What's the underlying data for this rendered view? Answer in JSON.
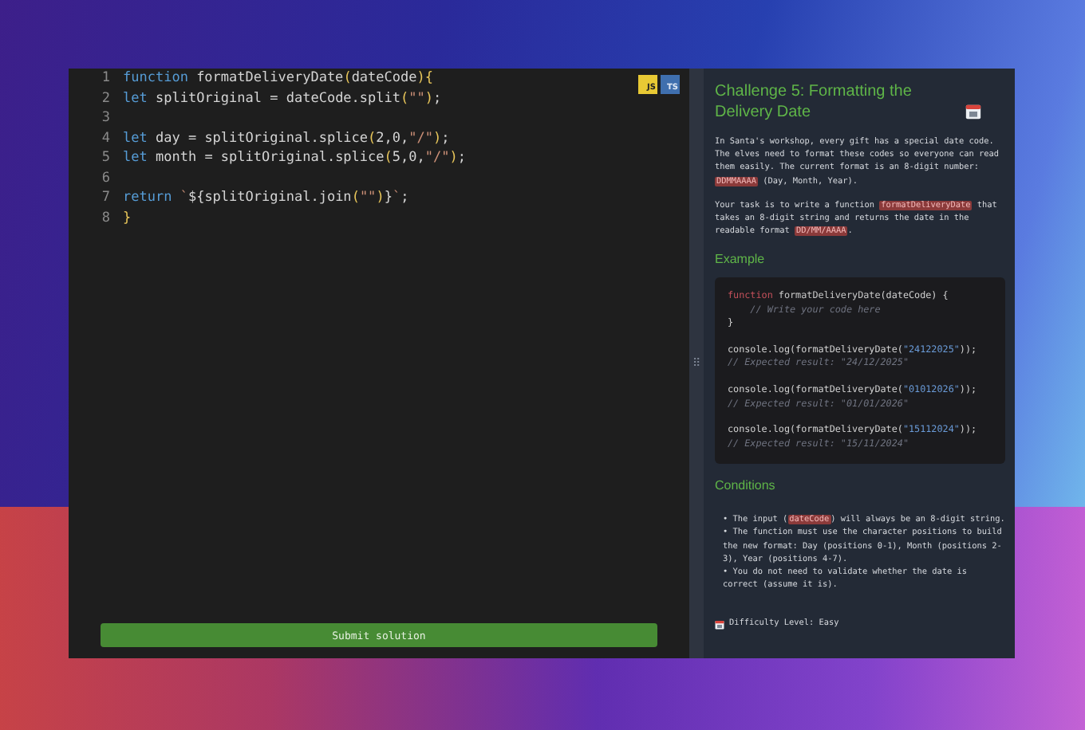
{
  "editor": {
    "badges": [
      {
        "kind": "js",
        "label": "JS"
      },
      {
        "kind": "ts",
        "label": "TS"
      }
    ],
    "lines": [
      {
        "number": "1",
        "tokens": [
          {
            "kind": "keyword",
            "text": "function "
          },
          {
            "kind": "plain",
            "text": "formatDeliveryDate"
          },
          {
            "kind": "brace",
            "text": "("
          },
          {
            "kind": "plain",
            "text": "dateCode"
          },
          {
            "kind": "brace",
            "text": "){"
          }
        ]
      },
      {
        "number": "2",
        "tokens": [
          {
            "kind": "keyword",
            "text": "let "
          },
          {
            "kind": "plain",
            "text": "splitOriginal = dateCode.split"
          },
          {
            "kind": "brace",
            "text": "("
          },
          {
            "kind": "string",
            "text": "\"\""
          },
          {
            "kind": "brace",
            "text": ")"
          },
          {
            "kind": "plain",
            "text": ";"
          }
        ]
      },
      {
        "number": "3"
      },
      {
        "number": "4",
        "tokens": [
          {
            "kind": "keyword",
            "text": "let "
          },
          {
            "kind": "plain",
            "text": "day = splitOriginal.splice"
          },
          {
            "kind": "brace",
            "text": "("
          },
          {
            "kind": "plain",
            "text": "2,0,"
          },
          {
            "kind": "string",
            "text": "\"/\""
          },
          {
            "kind": "brace",
            "text": ")"
          },
          {
            "kind": "plain",
            "text": ";"
          }
        ]
      },
      {
        "number": "5",
        "tokens": [
          {
            "kind": "keyword",
            "text": "let "
          },
          {
            "kind": "plain",
            "text": "month = splitOriginal.splice"
          },
          {
            "kind": "brace",
            "text": "("
          },
          {
            "kind": "plain",
            "text": "5,0,"
          },
          {
            "kind": "string",
            "text": "\"/\""
          },
          {
            "kind": "brace",
            "text": ")"
          },
          {
            "kind": "plain",
            "text": ";"
          }
        ]
      },
      {
        "number": "6"
      },
      {
        "number": "7",
        "tokens": [
          {
            "kind": "keyword",
            "text": "return "
          },
          {
            "kind": "string",
            "text": "`"
          },
          {
            "kind": "plain",
            "text": "${splitOriginal.join"
          },
          {
            "kind": "brace",
            "text": "("
          },
          {
            "kind": "string",
            "text": "\"\""
          },
          {
            "kind": "brace",
            "text": ")"
          },
          {
            "kind": "plain",
            "text": "}"
          },
          {
            "kind": "string",
            "text": "`"
          },
          {
            "kind": "plain",
            "text": ";"
          }
        ]
      },
      {
        "number": "8",
        "tokens": [
          {
            "kind": "brace",
            "text": "}"
          }
        ]
      }
    ],
    "submit_button": "Submit solution"
  },
  "splitter": {
    "handle": "⠿"
  },
  "challenge": {
    "title": "Challenge 5: Formatting the Delivery Date",
    "paragraphs": [
      [
        {
          "kind": "text",
          "text": "In Santa's workshop, every gift has a special date code. The elves need to format these codes so everyone can read them easily. The current format is an 8-digit number: "
        },
        {
          "kind": "code",
          "text": "DDMMAAAA"
        },
        {
          "kind": "text",
          "text": " (Day, Month, Year)."
        }
      ],
      [
        {
          "kind": "text",
          "text": "Your task is to write a function "
        },
        {
          "kind": "code",
          "text": "formatDeliveryDate"
        },
        {
          "kind": "text",
          "text": " that takes an 8-digit string and returns the date in the readable format "
        },
        {
          "kind": "code",
          "text": "DD/MM/AAAA"
        },
        {
          "kind": "text",
          "text": "."
        }
      ]
    ],
    "example_heading": "Example",
    "example_groups": [
      [
        [
          {
            "kind": "keyword",
            "text": "function "
          },
          {
            "kind": "fn",
            "text": "formatDeliveryDate"
          },
          {
            "kind": "plain",
            "text": "(dateCode) {"
          }
        ],
        [
          {
            "kind": "comment",
            "text": "    // Write your code here"
          }
        ],
        [
          {
            "kind": "plain",
            "text": "}"
          }
        ]
      ],
      [
        [
          {
            "kind": "plain",
            "text": "console.log(formatDeliveryDate("
          },
          {
            "kind": "string",
            "text": "\"24122025\""
          },
          {
            "kind": "plain",
            "text": "));"
          }
        ],
        [
          {
            "kind": "comment",
            "text": "// Expected result: \"24/12/2025\""
          }
        ]
      ],
      [
        [
          {
            "kind": "plain",
            "text": "console.log(formatDeliveryDate("
          },
          {
            "kind": "string",
            "text": "\"01012026\""
          },
          {
            "kind": "plain",
            "text": "));"
          }
        ],
        [
          {
            "kind": "comment",
            "text": "// Expected result: \"01/01/2026\""
          }
        ]
      ],
      [
        [
          {
            "kind": "plain",
            "text": "console.log(formatDeliveryDate("
          },
          {
            "kind": "string",
            "text": "\"15112024\""
          },
          {
            "kind": "plain",
            "text": "));"
          }
        ],
        [
          {
            "kind": "comment",
            "text": "// Expected result: \"15/11/2024\""
          }
        ]
      ]
    ],
    "conditions_heading": "Conditions",
    "conditions": [
      [
        {
          "kind": "text",
          "text": "• The input ("
        },
        {
          "kind": "code",
          "text": "dateCode"
        },
        {
          "kind": "text",
          "text": ") will always be an 8-digit string."
        }
      ],
      [
        {
          "kind": "text",
          "text": "• The function must use the character positions to build the new format: Day (positions 0-1), Month (positions 2-3), Year (positions 4-7)."
        }
      ],
      [
        {
          "kind": "text",
          "text": "• You do not need to validate whether the date is correct (assume it is)."
        }
      ]
    ],
    "difficulty": "Difficulty Level: Easy"
  }
}
